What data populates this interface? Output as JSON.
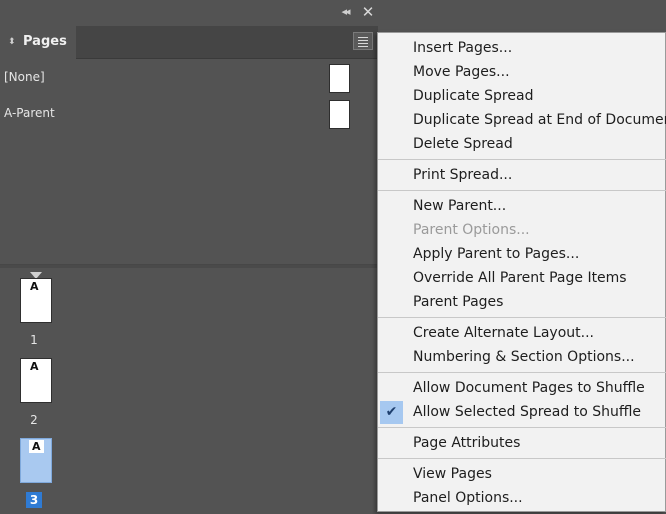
{
  "window": {
    "collapse_glyph": "◂◂",
    "close_glyph": "✕"
  },
  "panel": {
    "tab_title": "Pages",
    "tab_arrows": "⬍",
    "parents": [
      {
        "label": "[None]"
      },
      {
        "label": "A-Parent"
      }
    ],
    "pages": [
      {
        "number": "1",
        "parent": "A",
        "selected": false
      },
      {
        "number": "2",
        "parent": "A",
        "selected": false
      },
      {
        "number": "3",
        "parent": "A",
        "selected": true
      }
    ]
  },
  "menu": {
    "check_glyph": "✔",
    "items": [
      {
        "label": "Insert Pages..."
      },
      {
        "label": "Move Pages..."
      },
      {
        "label": "Duplicate Spread"
      },
      {
        "label": "Duplicate Spread at End of Document"
      },
      {
        "label": "Delete Spread"
      },
      {
        "label": "Print Spread..."
      },
      {
        "label": "New Parent..."
      },
      {
        "label": "Parent Options...",
        "disabled": true
      },
      {
        "label": "Apply Parent to Pages..."
      },
      {
        "label": "Override All Parent Page Items"
      },
      {
        "label": "Parent Pages"
      },
      {
        "label": "Create Alternate Layout..."
      },
      {
        "label": "Numbering & Section Options..."
      },
      {
        "label": "Allow Document Pages to Shuffle"
      },
      {
        "label": "Allow Selected Spread to Shuffle",
        "checked": true
      },
      {
        "label": "Page Attributes"
      },
      {
        "label": "View Pages"
      },
      {
        "label": "Panel Options..."
      }
    ]
  },
  "colors": {
    "panel_bg": "#535353",
    "menu_bg": "#f2f2f2",
    "selection_blue": "#2f7bd4",
    "check_highlight": "#a6c8f0"
  }
}
